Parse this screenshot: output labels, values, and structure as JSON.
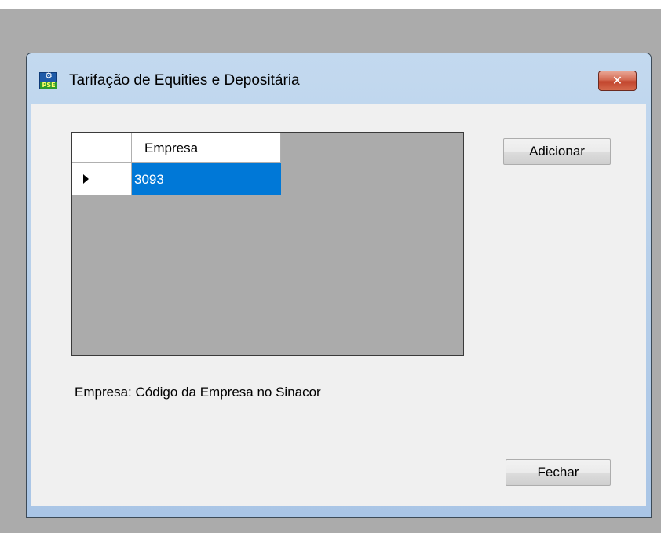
{
  "window": {
    "title": "Tarifação de Equities e Depositária",
    "icon": "pse-app-icon",
    "icon_label": "PSE",
    "close_glyph": "✕"
  },
  "grid": {
    "columns": [
      "Empresa"
    ],
    "rows": [
      {
        "selected": true,
        "cells": [
          "3093"
        ]
      }
    ]
  },
  "buttons": {
    "add_label": "Adicionar",
    "close_label": "Fechar"
  },
  "info": {
    "text": "Empresa: Código da Empresa no Sinacor"
  },
  "colors": {
    "selection": "#0078d7",
    "grid_background": "#ababab",
    "close_button": "#c2452d"
  }
}
